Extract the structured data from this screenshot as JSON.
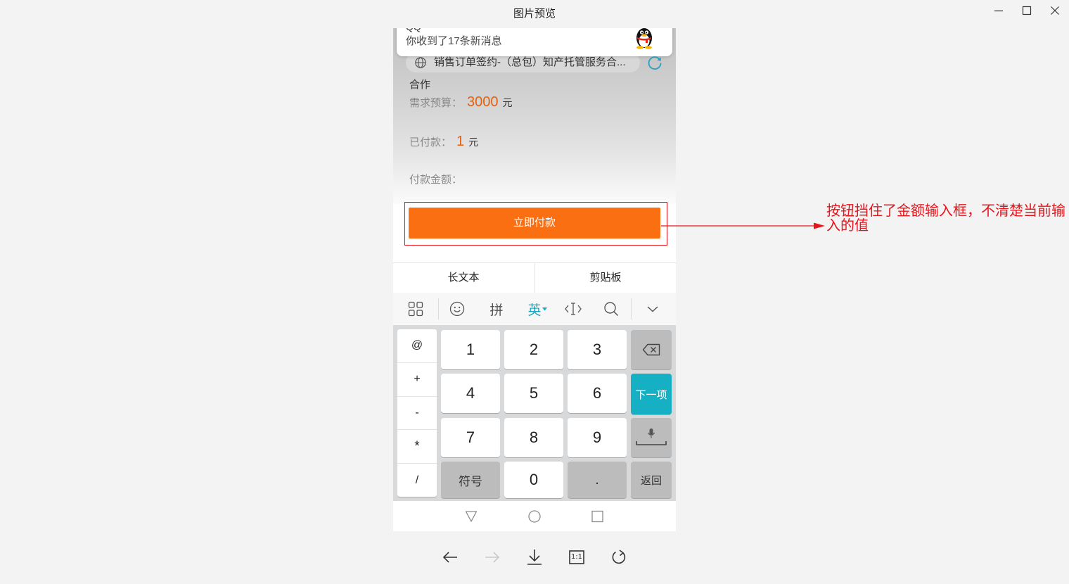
{
  "window": {
    "title": "图片预览",
    "controls": [
      "minimize-icon",
      "maximize-icon",
      "close-icon"
    ]
  },
  "phone": {
    "notification": {
      "app": "QQ",
      "message": "你收到了17条新消息",
      "icon": "qq-penguin-icon"
    },
    "order": {
      "pill_icon": "globe-icon",
      "pill_text": "销售订单签约-（总包）知产托管服务合...",
      "refresh_icon": "refresh-icon",
      "category": "合作",
      "budget": {
        "label": "需求预算：",
        "value": "3000",
        "unit": "元"
      },
      "paid": {
        "label": "已付款：",
        "value": "1",
        "unit": "元"
      },
      "amount": {
        "label": "付款金额："
      },
      "pay_button": "立即付款"
    },
    "keyboard": {
      "suggestions": [
        "长文本",
        "剪贴板"
      ],
      "toolbar": {
        "menu_icon": "grid-icon",
        "emoji_icon": "smiley-icon",
        "pinyin": "拼",
        "english": "英",
        "cursor_icon": "text-cursor-icon",
        "search_icon": "search-icon",
        "hide_icon": "chevron-down-icon"
      },
      "symbols": [
        "@",
        "+",
        "-",
        "*",
        "/"
      ],
      "digits": [
        "1",
        "2",
        "3",
        "4",
        "5",
        "6",
        "7",
        "8",
        "9"
      ],
      "symbol_key": "符号",
      "zero_key": "0",
      "dot_key": ".",
      "backspace_icon": "backspace-icon",
      "next_key": "下一项",
      "voice_icon": "microphone-icon",
      "back_key": "返回"
    },
    "navbar": [
      "back-triangle-icon",
      "home-circle-icon",
      "recents-square-icon"
    ]
  },
  "annotation": {
    "text": "按钮挡住了金额输入框，不清楚当前输入的值",
    "color": "#e8141b"
  },
  "viewer_toolbar": {
    "actual_size_label": "1:1",
    "icons": [
      "arrow-left-icon",
      "arrow-right-icon",
      "download-icon",
      "actual-size-icon",
      "rotate-icon"
    ]
  },
  "colors": {
    "pay_button": "#fb6f13",
    "amount_value": "#e5600f",
    "keyboard_accent": "#16b0c5",
    "annotation": "#e8141b"
  }
}
